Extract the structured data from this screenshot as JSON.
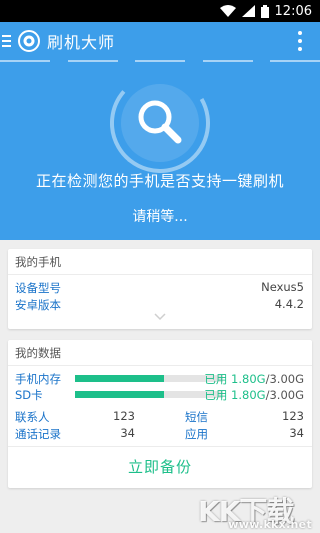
{
  "status_bar": {
    "time": "12:06"
  },
  "app_bar": {
    "title": "刷机大师",
    "menu_icon": "hamburger-icon",
    "more_icon": "more-vert-icon"
  },
  "hero": {
    "detect_text": "正在检测您的手机是否支持一键刷机",
    "wait_text": "请稍等...",
    "icon": "search-icon"
  },
  "phone_card": {
    "title": "我的手机",
    "rows": [
      {
        "label": "设备型号",
        "value": "Nexus5"
      },
      {
        "label": "安卓版本",
        "value": "4.4.2"
      }
    ]
  },
  "data_card": {
    "title": "我的数据",
    "storage": [
      {
        "label": "手机内存",
        "used_prefix": "已用 1.80G",
        "total": "/3.00G",
        "fraction": 0.6
      },
      {
        "label": "SD卡",
        "used_prefix": "已用 1.80G",
        "total": "/3.00G",
        "fraction": 0.6
      }
    ],
    "stats": [
      {
        "label": "联系人",
        "value": "123"
      },
      {
        "label": "短信",
        "value": "123"
      },
      {
        "label": "通话记录",
        "value": "34"
      },
      {
        "label": "应用",
        "value": "34"
      }
    ],
    "backup_label": "立即备份"
  },
  "watermark": {
    "mark": "KK下载",
    "site": "www.kkx.net"
  },
  "colors": {
    "primary": "#3d9eea",
    "accent": "#1dbf8a",
    "label": "#1a73c9"
  }
}
